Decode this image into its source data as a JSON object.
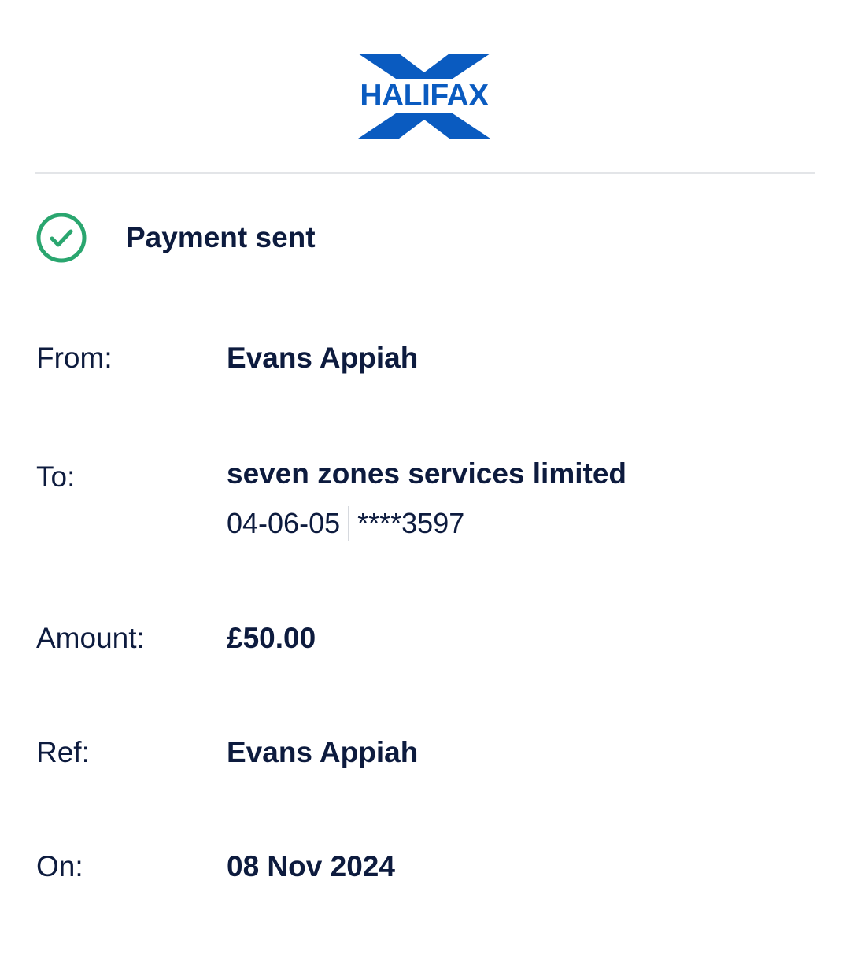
{
  "brand": {
    "logo_text": "HALIFAX",
    "colors": {
      "logo_blue": "#0a5bc0",
      "success_green": "#2aa66f",
      "text_navy": "#0d1b3e"
    }
  },
  "status": {
    "icon": "check-circle-icon",
    "text": "Payment sent"
  },
  "details": {
    "from": {
      "label": "From:",
      "value": "Evans Appiah"
    },
    "to": {
      "label": "To:",
      "value": "seven zones services limited",
      "sort_code": "04-06-05",
      "account_number": "****3597"
    },
    "amount": {
      "label": "Amount:",
      "value": "£50.00"
    },
    "ref": {
      "label": "Ref:",
      "value": "Evans Appiah"
    },
    "on": {
      "label": "On:",
      "value": "08 Nov 2024"
    }
  }
}
